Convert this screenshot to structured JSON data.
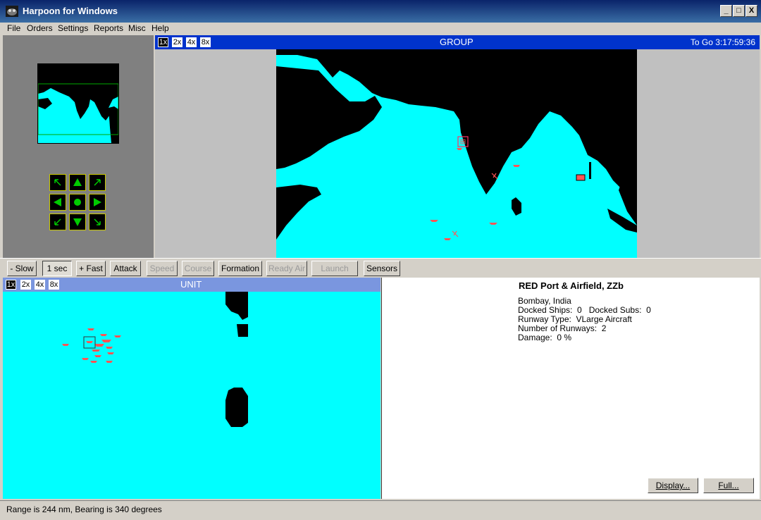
{
  "window": {
    "title": "Harpoon for Windows",
    "min": "_",
    "max": "□",
    "close": "X"
  },
  "menu": [
    "File",
    "Orders",
    "Settings",
    "Reports",
    "Misc",
    "Help"
  ],
  "group": {
    "title": "GROUP",
    "zoom": [
      "1x",
      "2x",
      "4x",
      "8x"
    ],
    "timer": "To Go 3:17:59:36"
  },
  "unit": {
    "title": "UNIT",
    "zoom": [
      "1x",
      "2x",
      "4x",
      "8x"
    ]
  },
  "toolbar": {
    "slow": "- Slow",
    "time": "1 sec",
    "fast": "+ Fast",
    "attack": "Attack",
    "speed": "Speed",
    "course": "Course",
    "formation": "Formation",
    "ready_air": "Ready Air",
    "launch": "Launch",
    "sensors": "Sensors"
  },
  "info": {
    "title": "RED Port & Airfield, ZZb",
    "lines": [
      "Bombay, India",
      "Docked Ships:  0   Docked Subs:  0",
      "Runway Type:  VLarge Aircraft",
      "Number of Runways:  2",
      "Damage:  0 %"
    ],
    "display_btn": "Display...",
    "full_btn": "Full..."
  },
  "status": "Range is 244 nm, Bearing is 340 degrees",
  "colors": {
    "sea": "#00ffff",
    "land": "#000000",
    "unit": "#ff5555",
    "accent": "#0033cc"
  }
}
